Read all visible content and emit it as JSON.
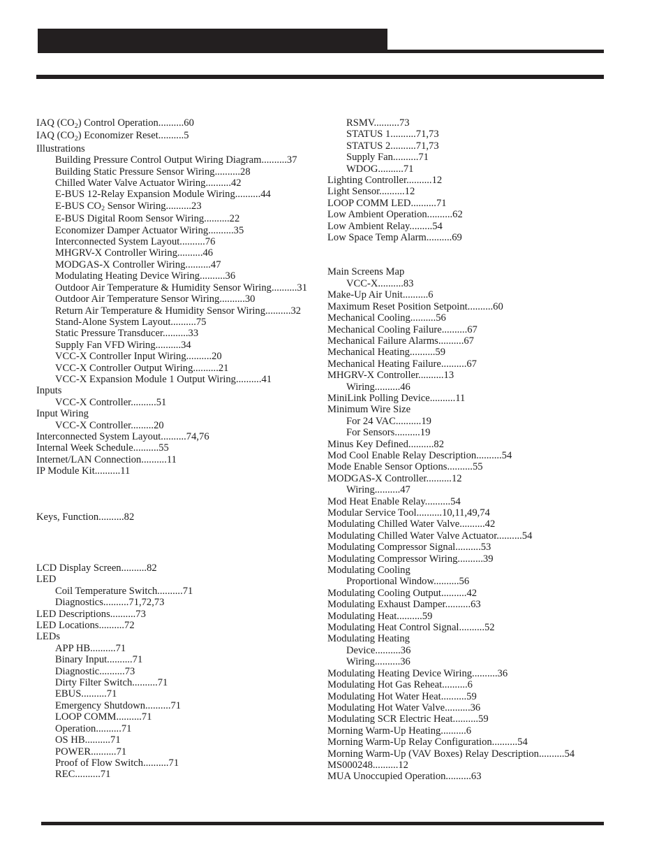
{
  "header": {
    "title": ""
  },
  "columns": {
    "left": [
      {
        "level": 1,
        "text": "IAQ (CO₂) Control Operation..........60"
      },
      {
        "level": 1,
        "text": "IAQ (CO₂) Economizer Reset..........5"
      },
      {
        "level": 1,
        "text": "Illustrations"
      },
      {
        "level": 2,
        "text": "Building Pressure Control Output Wiring Diagram..........37"
      },
      {
        "level": 2,
        "text": "Building Static Pressure Sensor Wiring..........28"
      },
      {
        "level": 2,
        "text": "Chilled Water Valve Actuator Wiring..........42"
      },
      {
        "level": 2,
        "text": "E-BUS 12-Relay Expansion Module Wiring..........44"
      },
      {
        "level": 2,
        "text": "E-BUS CO₂ Sensor Wiring..........23"
      },
      {
        "level": 2,
        "text": "E-BUS Digital Room Sensor Wiring..........22"
      },
      {
        "level": 2,
        "text": "Economizer Damper Actuator Wiring..........35"
      },
      {
        "level": 2,
        "text": "Interconnected System Layout..........76"
      },
      {
        "level": 2,
        "text": "MHGRV-X Controller Wiring..........46"
      },
      {
        "level": 2,
        "text": "MODGAS-X Controller Wiring..........47"
      },
      {
        "level": 2,
        "text": "Modulating Heating Device Wiring..........36"
      },
      {
        "level": 2,
        "text": "Outdoor Air Temperature & Humidity Sensor Wiring..........31"
      },
      {
        "level": 2,
        "text": "Outdoor Air Temperature Sensor Wiring..........30"
      },
      {
        "level": 2,
        "text": "Return Air Temperature & Humidity Sensor Wiring..........32"
      },
      {
        "level": 2,
        "text": "Stand-Alone System Layout..........75"
      },
      {
        "level": 2,
        "text": "Static Pressure Transducer..........33"
      },
      {
        "level": 2,
        "text": "Supply Fan VFD Wiring..........34"
      },
      {
        "level": 2,
        "text": "VCC-X Controller Input Wiring..........20"
      },
      {
        "level": 2,
        "text": "VCC-X Controller Output Wiring..........21"
      },
      {
        "level": 2,
        "text": "VCC-X Expansion Module 1 Output Wiring..........41"
      },
      {
        "level": 1,
        "text": "Inputs"
      },
      {
        "level": 2,
        "text": "VCC-X Controller..........51"
      },
      {
        "level": 1,
        "text": "Input Wiring"
      },
      {
        "level": 2,
        "text": "VCC-X Controller.........20"
      },
      {
        "level": 1,
        "text": "Interconnected System Layout..........74,76"
      },
      {
        "level": 1,
        "text": "Internal Week Schedule..........55"
      },
      {
        "level": 1,
        "text": "Internet/LAN Connection..........11"
      },
      {
        "level": 1,
        "text": "IP Module Kit..........11"
      },
      {
        "level": 0,
        "text": "",
        "spacer": "big"
      },
      {
        "level": 1,
        "text": "Keys, Function..........82"
      },
      {
        "level": 0,
        "text": "",
        "spacer": "xbig"
      },
      {
        "level": 1,
        "text": "LCD Display Screen..........82"
      },
      {
        "level": 1,
        "text": "LED"
      },
      {
        "level": 2,
        "text": "Coil Temperature Switch..........71"
      },
      {
        "level": 2,
        "text": "Diagnostics..........71,72,73"
      },
      {
        "level": 1,
        "text": "LED Descriptions..........73"
      },
      {
        "level": 1,
        "text": "LED Locations..........72"
      },
      {
        "level": 1,
        "text": "LEDs"
      },
      {
        "level": 2,
        "text": "APP HB..........71"
      },
      {
        "level": 2,
        "text": "Binary Input..........71"
      },
      {
        "level": 2,
        "text": "Diagnostic..........73"
      },
      {
        "level": 2,
        "text": "Dirty Filter Switch..........71"
      },
      {
        "level": 2,
        "text": "EBUS..........71"
      },
      {
        "level": 2,
        "text": "Emergency Shutdown..........71"
      },
      {
        "level": 2,
        "text": "LOOP COMM..........71"
      },
      {
        "level": 2,
        "text": "Operation..........71"
      },
      {
        "level": 2,
        "text": "OS HB..........71"
      },
      {
        "level": 2,
        "text": "POWER..........71"
      },
      {
        "level": 2,
        "text": "Proof of Flow Switch..........71"
      },
      {
        "level": 2,
        "text": "REC..........71"
      }
    ],
    "right": [
      {
        "level": 2,
        "text": "RSMV..........73"
      },
      {
        "level": 2,
        "text": "STATUS 1..........71,73"
      },
      {
        "level": 2,
        "text": "STATUS 2..........71,73"
      },
      {
        "level": 2,
        "text": "Supply Fan..........71"
      },
      {
        "level": 2,
        "text": "WDOG..........71"
      },
      {
        "level": 1,
        "text": "Lighting Controller..........12"
      },
      {
        "level": 1,
        "text": "Light Sensor..........12"
      },
      {
        "level": 1,
        "text": "LOOP COMM LED..........71"
      },
      {
        "level": 1,
        "text": "Low Ambient Operation..........62"
      },
      {
        "level": 1,
        "text": "Low Ambient Relay.........54"
      },
      {
        "level": 1,
        "text": "Low Space Temp Alarm..........69"
      },
      {
        "level": 0,
        "text": "",
        "spacer": "med"
      },
      {
        "level": 1,
        "text": "Main Screens Map"
      },
      {
        "level": 2,
        "text": "VCC-X..........83"
      },
      {
        "level": 1,
        "text": "Make-Up Air Unit..........6"
      },
      {
        "level": 1,
        "text": "Maximum Reset Position Setpoint..........60"
      },
      {
        "level": 1,
        "text": "Mechanical Cooling..........56"
      },
      {
        "level": 1,
        "text": "Mechanical Cooling Failure..........67"
      },
      {
        "level": 1,
        "text": "Mechanical Failure Alarms..........67"
      },
      {
        "level": 1,
        "text": "Mechanical Heating..........59"
      },
      {
        "level": 1,
        "text": "Mechanical Heating Failure..........67"
      },
      {
        "level": 1,
        "text": "MHGRV-X Controller..........13"
      },
      {
        "level": 2,
        "text": "Wiring..........46"
      },
      {
        "level": 1,
        "text": "MiniLink Polling Device..........11"
      },
      {
        "level": 1,
        "text": "Minimum Wire Size"
      },
      {
        "level": 2,
        "text": "For 24 VAC..........19"
      },
      {
        "level": 2,
        "text": "For Sensors..........19"
      },
      {
        "level": 1,
        "text": "Minus Key Defined..........82"
      },
      {
        "level": 1,
        "text": "Mod Cool Enable Relay Description..........54"
      },
      {
        "level": 1,
        "text": "Mode Enable Sensor Options..........55"
      },
      {
        "level": 1,
        "text": "MODGAS-X Controller..........12"
      },
      {
        "level": 2,
        "text": "Wiring..........47"
      },
      {
        "level": 1,
        "text": "Mod Heat Enable Relay..........54"
      },
      {
        "level": 1,
        "text": "Modular Service Tool..........10,11,49,74"
      },
      {
        "level": 1,
        "text": "Modulating Chilled Water Valve..........42"
      },
      {
        "level": 1,
        "text": "Modulating Chilled Water Valve Actuator..........54"
      },
      {
        "level": 1,
        "text": "Modulating Compressor Signal..........53"
      },
      {
        "level": 1,
        "text": "Modulating Compressor Wiring..........39"
      },
      {
        "level": 1,
        "text": "Modulating Cooling"
      },
      {
        "level": 2,
        "text": "Proportional Window..........56"
      },
      {
        "level": 1,
        "text": "Modulating Cooling Output..........42"
      },
      {
        "level": 1,
        "text": "Modulating Exhaust Damper..........63"
      },
      {
        "level": 1,
        "text": "Modulating Heat..........59"
      },
      {
        "level": 1,
        "text": "Modulating Heat Control Signal..........52"
      },
      {
        "level": 1,
        "text": "Modulating Heating"
      },
      {
        "level": 2,
        "text": "Device..........36"
      },
      {
        "level": 2,
        "text": "Wiring..........36"
      },
      {
        "level": 1,
        "text": "Modulating Heating Device Wiring..........36"
      },
      {
        "level": 1,
        "text": "Modulating Hot Gas Reheat..........6"
      },
      {
        "level": 1,
        "text": "Modulating Hot Water Heat..........59"
      },
      {
        "level": 1,
        "text": "Modulating Hot Water Valve..........36"
      },
      {
        "level": 1,
        "text": "Modulating SCR Electric Heat..........59"
      },
      {
        "level": 1,
        "text": "Morning Warm-Up Heating..........6"
      },
      {
        "level": 1,
        "text": "Morning Warm-Up Relay Configuration..........54"
      },
      {
        "level": 1,
        "text": "Morning Warm-Up (VAV Boxes) Relay Description..........54"
      },
      {
        "level": 1,
        "text": "MS000248..........12"
      },
      {
        "level": 1,
        "text": "MUA Unoccupied Operation..........63"
      }
    ]
  },
  "colors": {
    "ink": "#231f20",
    "page": "#ffffff"
  }
}
